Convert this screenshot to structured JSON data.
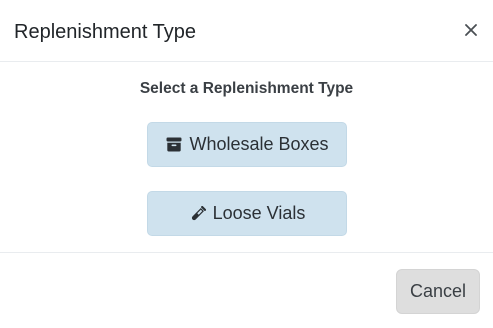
{
  "header": {
    "title": "Replenishment Type",
    "close_icon": "close-icon",
    "close_glyph": "×"
  },
  "body": {
    "prompt": "Select a Replenishment Type",
    "options": [
      {
        "label": "Wholesale Boxes",
        "icon": "box-icon"
      },
      {
        "label": "Loose Vials",
        "icon": "vial-icon"
      }
    ]
  },
  "footer": {
    "cancel_label": "Cancel"
  },
  "colors": {
    "option_button_bg": "#cfe2ee",
    "cancel_button_bg": "#dedede",
    "text": "#212529"
  }
}
